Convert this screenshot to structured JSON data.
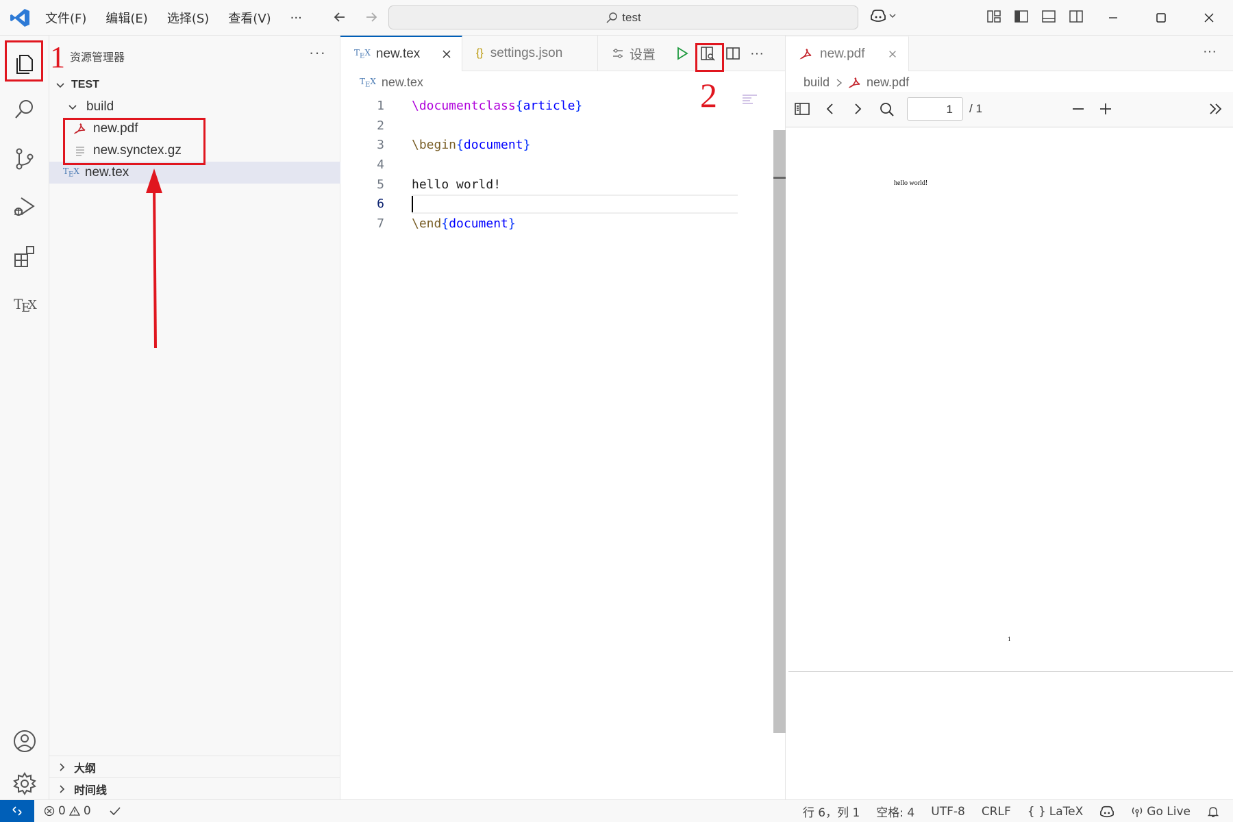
{
  "titlebar": {
    "menu": [
      "文件(F)",
      "编辑(E)",
      "选择(S)",
      "查看(V)",
      "···"
    ],
    "search_text": "test"
  },
  "sidebar": {
    "title": "资源管理器",
    "more": "···",
    "root_folder": "TEST",
    "folder_build": "build",
    "files": [
      "new.pdf",
      "new.synctex.gz",
      "new.tex"
    ],
    "outline": "大纲",
    "timeline": "时间线"
  },
  "editor1": {
    "tabs": [
      {
        "label": "new.tex",
        "icon": "tex-icon",
        "active": true
      },
      {
        "label": "settings.json",
        "icon": "json-icon",
        "active": false
      },
      {
        "label": "设置",
        "icon": "settings-icon",
        "active": false
      }
    ],
    "breadcrumb": "new.tex",
    "lines": [
      {
        "n": "1"
      },
      {
        "n": "2"
      },
      {
        "n": "3"
      },
      {
        "n": "4"
      },
      {
        "n": "5"
      },
      {
        "n": "6"
      },
      {
        "n": "7"
      }
    ],
    "code": {
      "l1_cmd": "\\documentclass",
      "l1_arg": "article",
      "l3_cmd": "\\begin",
      "l3_arg": "document",
      "l5_text": "hello world!",
      "l7_cmd": "\\end",
      "l7_arg": "document"
    }
  },
  "editor2": {
    "tab_label": "new.pdf",
    "breadcrumb_folder": "build",
    "breadcrumb_file": "new.pdf",
    "page_input": "1",
    "page_total": "/ 1",
    "pdf_text": "hello world!",
    "pdf_page_number": "1"
  },
  "statusbar": {
    "errors": "0",
    "warnings": "0",
    "position": "行 6，列 1",
    "spaces": "空格: 4",
    "encoding": "UTF-8",
    "eol": "CRLF",
    "language": "LaTeX",
    "golive": "Go Live"
  },
  "annotations": {
    "num1": "1",
    "num2": "2"
  },
  "colors": {
    "accent": "#005fb8",
    "annotation_red": "#e0161f",
    "pdf_icon_red": "#c4262e"
  }
}
